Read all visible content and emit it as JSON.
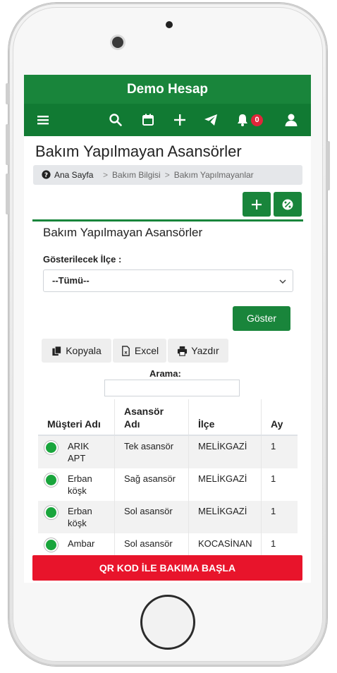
{
  "app": {
    "title": "Demo Hesap"
  },
  "nav": {
    "icons": [
      "menu-icon",
      "search-icon",
      "calendar-icon",
      "plus-icon",
      "send-icon",
      "bell-icon",
      "user-icon"
    ],
    "notification_count": "0"
  },
  "page": {
    "title": "Bakım Yapılmayan Asansörler"
  },
  "breadcrumb": {
    "home": "Ana Sayfa",
    "items": [
      "Bakım Bilgisi",
      "Bakım Yapılmayanlar"
    ],
    "separator": ">"
  },
  "card": {
    "title": "Bakım Yapılmayan Asansörler"
  },
  "filter": {
    "label": "Gösterilecek İlçe :",
    "selected": "--Tümü--",
    "show_button": "Göster"
  },
  "tools": {
    "copy": "Kopyala",
    "excel": "Excel",
    "print": "Yazdır"
  },
  "search": {
    "label": "Arama:",
    "value": ""
  },
  "table": {
    "headers": [
      "Müşteri Adı",
      "Asansör Adı",
      "İlçe",
      "Ay"
    ],
    "rows": [
      {
        "customer": "ARIK APT",
        "elevator": "Tek asansör",
        "district": "MELİKGAZİ",
        "month": "1"
      },
      {
        "customer": "Erban köşk",
        "elevator": "Sağ asansör",
        "district": "MELİKGAZİ",
        "month": "1"
      },
      {
        "customer": "Erban köşk",
        "elevator": "Sol asansör",
        "district": "MELİKGAZİ",
        "month": "1"
      },
      {
        "customer": "Ambar",
        "elevator": "Sol asansör",
        "district": "KOCASİNAN",
        "month": "1"
      }
    ]
  },
  "qr_button": "QR KOD İLE BAKIMA BAŞLA",
  "colors": {
    "primary": "#19853b",
    "danger": "#e8142b",
    "badge": "#e0263a",
    "status": "#19a53c"
  }
}
